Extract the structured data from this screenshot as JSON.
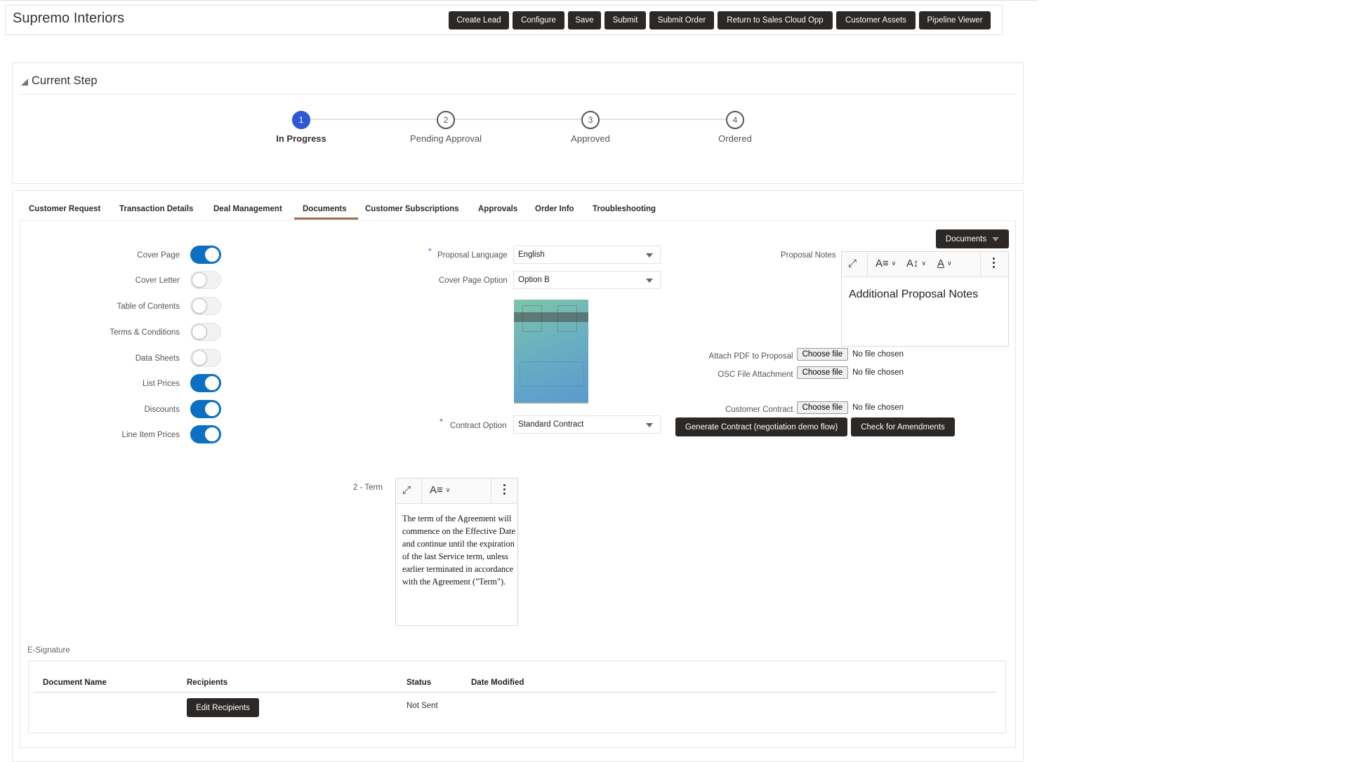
{
  "header": {
    "title": "Supremo Interiors",
    "buttons": [
      {
        "label": "Create Lead"
      },
      {
        "label": "Configure"
      },
      {
        "label": "Save"
      },
      {
        "label": "Submit"
      },
      {
        "label": "Submit Order"
      },
      {
        "label": "Return to Sales Cloud Opp"
      },
      {
        "label": "Customer Assets"
      },
      {
        "label": "Pipeline Viewer"
      }
    ]
  },
  "current_step": {
    "heading": "Current Step",
    "steps": [
      {
        "number": "1",
        "label": "In Progress",
        "state": "active"
      },
      {
        "number": "2",
        "label": "Pending Approval",
        "state": "pending"
      },
      {
        "number": "3",
        "label": "Approved",
        "state": "pending"
      },
      {
        "number": "4",
        "label": "Ordered",
        "state": "pending"
      }
    ],
    "active_color": "#3057d6"
  },
  "tabs": {
    "items": [
      {
        "label": "Customer Request"
      },
      {
        "label": "Transaction Details"
      },
      {
        "label": "Deal Management"
      },
      {
        "label": "Documents"
      },
      {
        "label": "Customer Subscriptions"
      },
      {
        "label": "Approvals"
      },
      {
        "label": "Order Info"
      },
      {
        "label": "Troubleshooting"
      }
    ],
    "active": "Documents",
    "accent_color": "#9b6b53"
  },
  "documents": {
    "menu_button_label": "Documents",
    "toggles": [
      {
        "label": "Cover Page",
        "on": true
      },
      {
        "label": "Cover Letter",
        "on": false
      },
      {
        "label": "Table of Contents",
        "on": false
      },
      {
        "label": "Terms & Conditions",
        "on": false
      },
      {
        "label": "Data Sheets",
        "on": false
      },
      {
        "label": "List Prices",
        "on": true
      },
      {
        "label": "Discounts",
        "on": true
      },
      {
        "label": "Line Item Prices",
        "on": true
      }
    ],
    "toggle_on_color": "#0b6fc4",
    "proposal_language": {
      "label": "Proposal Language",
      "required": "*",
      "value": "English"
    },
    "cover_page_option": {
      "label": "Cover Page Option",
      "value": "Option B"
    },
    "contract_option": {
      "label": "Contract Option",
      "required": "*",
      "value": "Standard Contract"
    },
    "proposal_notes": {
      "label": "Proposal Notes",
      "content": "Additional Proposal Notes"
    },
    "attachments": [
      {
        "label": "Attach PDF to Proposal",
        "button": "Choose file",
        "status": "No file chosen"
      },
      {
        "label": "OSC File Attachment",
        "button": "Choose file",
        "status": "No file chosen"
      },
      {
        "label": "Customer Contract",
        "button": "Choose file",
        "status": "No file chosen"
      }
    ],
    "actions": {
      "generate_contract": "Generate Contract (negotiation demo flow)",
      "check_amendments": "Check for Amendments"
    },
    "term": {
      "label": "2 - Term",
      "content": "The term of the Agreement will commence on the Effective Date and continue until the expiration of the last Service term, unless earlier terminated in accordance with the Agreement (\"Term\")."
    }
  },
  "esignature": {
    "label": "E-Signature",
    "columns": [
      "Document Name",
      "Recipients",
      "Status",
      "Date Modified"
    ],
    "rows": [
      {
        "document_name": "",
        "recipients_button": "Edit Recipients",
        "status": "Not Sent",
        "date_modified": ""
      }
    ]
  }
}
